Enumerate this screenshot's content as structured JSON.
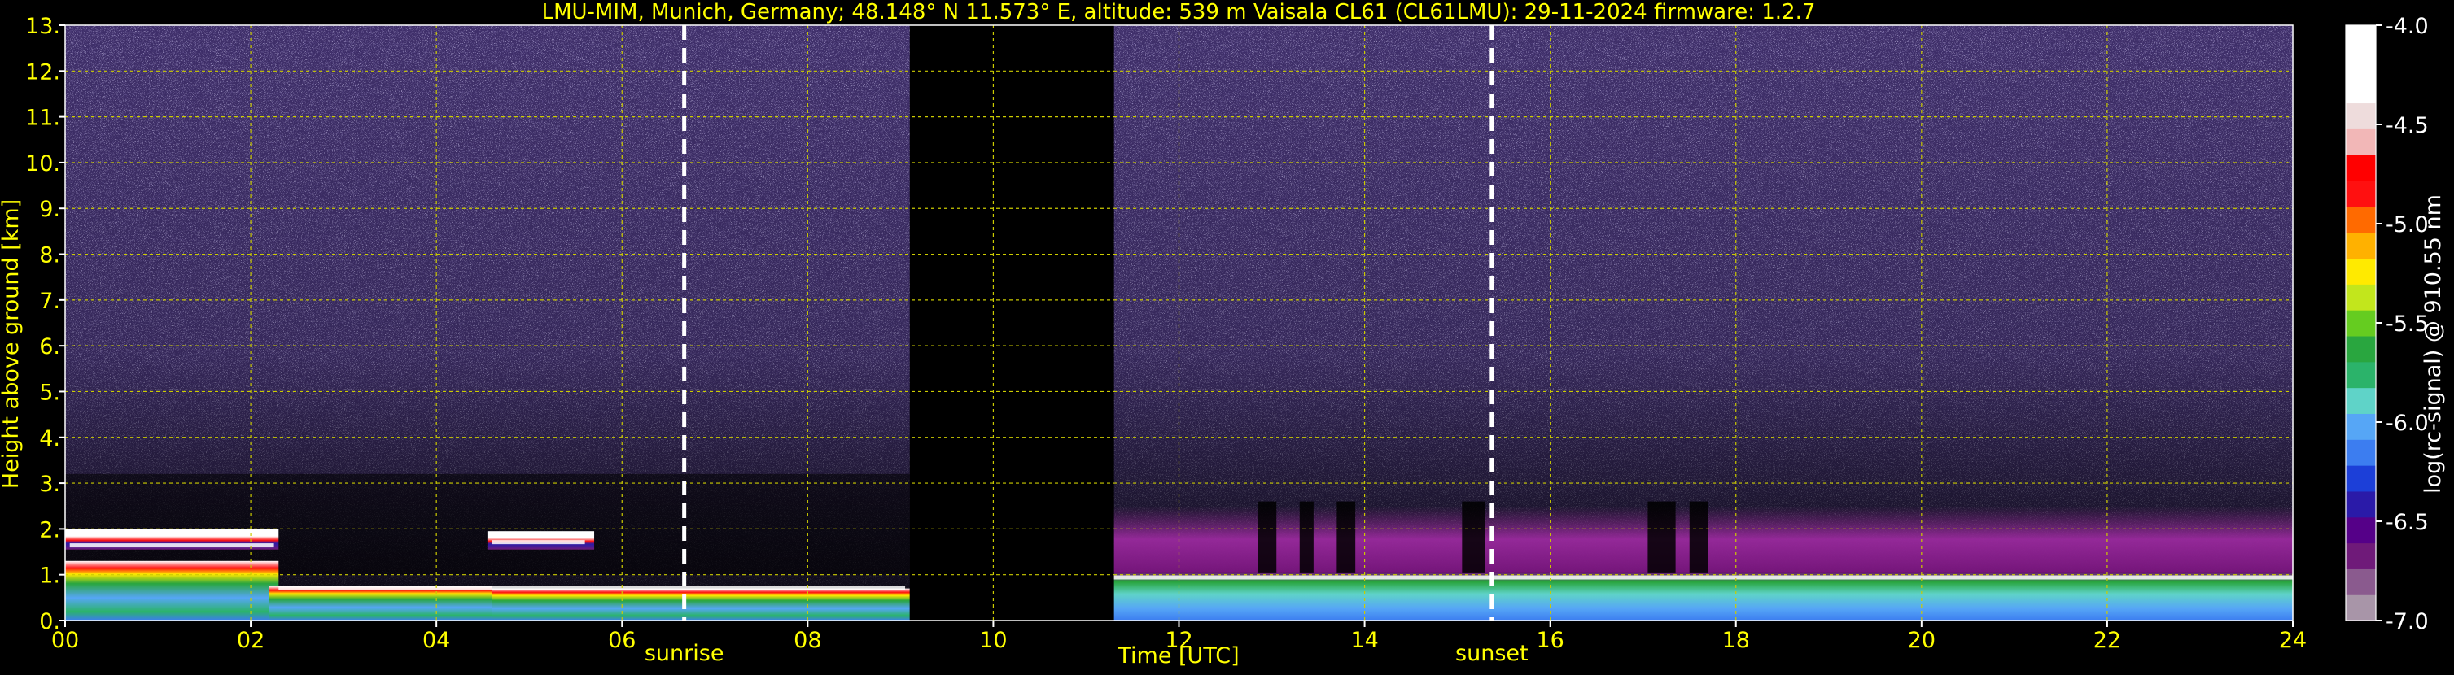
{
  "chart_data": {
    "type": "heatmap",
    "title": "LMU-MIM, Munich, Germany; 48.148° N 11.573° E, altitude: 539 m    Vaisala CL61 (CL61LMU): 29-11-2024    firmware: 1.2.7",
    "xlabel": "Time [UTC]",
    "ylabel": "Height above ground [km]",
    "xlim": [
      0,
      24
    ],
    "ylim": [
      0,
      13
    ],
    "xticks": [
      "00",
      "02",
      "04",
      "06",
      "08",
      "10",
      "12",
      "14",
      "16",
      "18",
      "20",
      "22",
      "24"
    ],
    "yticks": [
      "0.",
      "1.",
      "2.",
      "3.",
      "4.",
      "5.",
      "6.",
      "7.",
      "8.",
      "9.",
      "10.",
      "11.",
      "12.",
      "13."
    ],
    "grid": true,
    "colorbar": {
      "label": "log(rc-signal) @ 910.55 nm",
      "range": [
        -7.0,
        -4.0
      ],
      "ticks": [
        "-4.0",
        "-4.5",
        "-5.0",
        "-5.5",
        "-6.0",
        "-6.5",
        "-7.0"
      ]
    },
    "annotations": [
      {
        "label": "sunrise",
        "time": 6.67
      },
      {
        "label": "sunset",
        "time": 15.37
      }
    ],
    "layers": [
      {
        "start": 0.0,
        "end": 2.3,
        "bottom": 1.55,
        "top": 2.0,
        "kind": "cloud"
      },
      {
        "start": 0.0,
        "end": 2.3,
        "bottom": 0.0,
        "top": 1.3,
        "kind": "boundary"
      },
      {
        "start": 2.2,
        "end": 4.6,
        "bottom": 0.0,
        "top": 0.75,
        "kind": "boundary"
      },
      {
        "start": 4.55,
        "end": 5.7,
        "bottom": 1.55,
        "top": 1.95,
        "kind": "cloud"
      },
      {
        "start": 4.6,
        "end": 9.1,
        "bottom": 0.0,
        "top": 0.7,
        "kind": "boundary"
      },
      {
        "start": 9.1,
        "end": 11.3,
        "bottom": 0.0,
        "top": 13.0,
        "kind": "nodata"
      },
      {
        "start": 11.3,
        "end": 24.0,
        "bottom": 0.0,
        "top": 1.05,
        "kind": "boundary"
      },
      {
        "start": 11.3,
        "end": 24.0,
        "bottom": 1.05,
        "top": 2.5,
        "kind": "noise"
      }
    ]
  },
  "colors": {
    "text": "#ffff00",
    "white": "#ffffff",
    "background": "#000000",
    "noise": "#3f2f6a",
    "grid": "#cccc00",
    "colormap": [
      "#a895a8",
      "#8a5a8e",
      "#6f1a79",
      "#550088",
      "#2a1aa8",
      "#1c3fd8",
      "#3c7df0",
      "#56a6f6",
      "#5fd3c8",
      "#2bb36a",
      "#29a63f",
      "#65cc20",
      "#c2e61c",
      "#ffea00",
      "#ffb100",
      "#ff6a00",
      "#ff1010",
      "#ff0000",
      "#f2b7b7",
      "#eedcdc",
      "#ffffff",
      "#ffffff",
      "#ffffff"
    ]
  }
}
